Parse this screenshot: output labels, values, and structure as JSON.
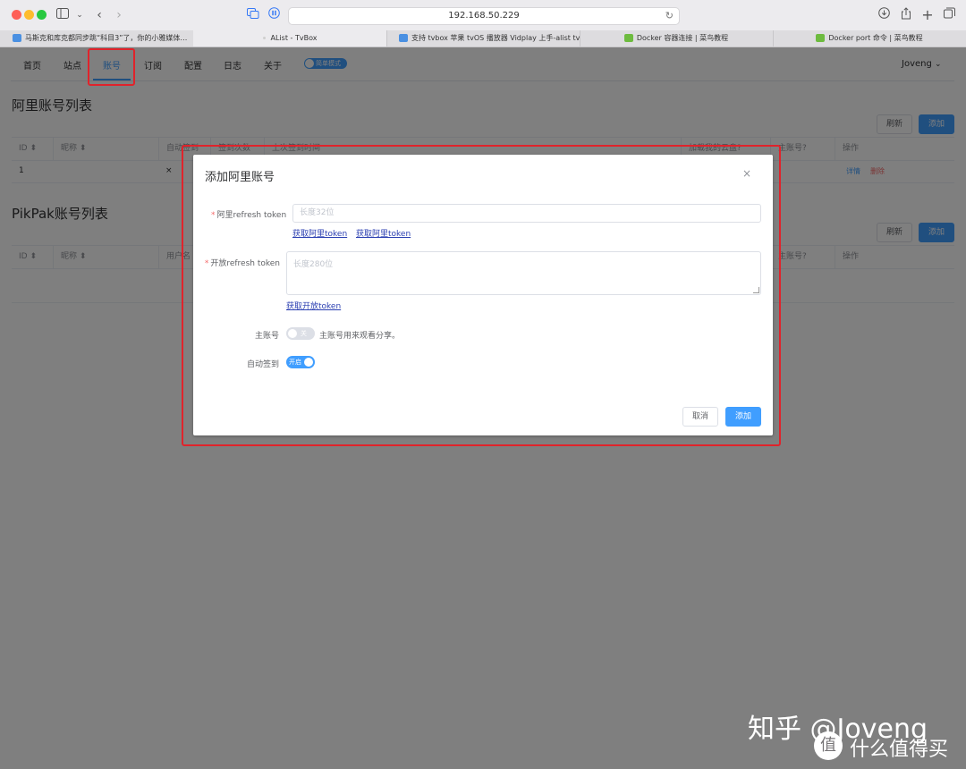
{
  "browser": {
    "url": "192.168.50.229",
    "tabs": [
      {
        "label": "马斯克和库克都同步跳“科目3”了，你的小雅媒体…",
        "favicon": "#4a90e2"
      },
      {
        "label": "AList - TvBox",
        "favicon": "#cfcfcf"
      },
      {
        "label": "支持 tvbox 苹果 tvOS 播放器 Vidplay 上手-alist tvb…",
        "favicon": "#4a90e2"
      },
      {
        "label": "Docker 容器连接 | 菜鸟教程",
        "favicon": "#6dbb3f"
      },
      {
        "label": "Docker port 命令 | 菜鸟教程",
        "favicon": "#6dbb3f"
      }
    ]
  },
  "nav": {
    "items": [
      "首页",
      "站点",
      "账号",
      "订阅",
      "配置",
      "日志",
      "关于"
    ],
    "active_index": 2,
    "simple_mode_label": "简单模式",
    "user": "Joveng"
  },
  "ali_section": {
    "title": "阿里账号列表",
    "refresh": "刷新",
    "add": "添加",
    "columns": [
      "ID",
      "昵称",
      "自动签到",
      "签到次数",
      "上次签到时间",
      "加载我的云盘?",
      "主账号?",
      "操作"
    ],
    "rows": [
      {
        "id": "1",
        "nickname": "",
        "auto_sign": "×",
        "detail": "详情",
        "delete": "删除"
      }
    ]
  },
  "pikpak_section": {
    "title": "PikPak账号列表",
    "refresh": "刷新",
    "add": "添加",
    "columns": [
      "ID",
      "昵称",
      "用户名",
      "主账号?",
      "操作"
    ]
  },
  "dialog": {
    "title": "添加阿里账号",
    "close": "×",
    "ali_token_label": "阿里refresh token",
    "ali_token_placeholder": "长度32位",
    "ali_links": [
      "获取阿里token",
      "获取阿里token"
    ],
    "open_token_label": "开放refresh token",
    "open_token_placeholder": "长度280位",
    "open_link": "获取开放token",
    "main_label": "主账号",
    "main_switch_text": "关",
    "main_helper": "主账号用来观看分享。",
    "auto_label": "自动签到",
    "auto_switch_text": "开启",
    "cancel": "取消",
    "add": "添加"
  },
  "watermark": {
    "text": "知乎 @Joveng",
    "logo_glyph": "值",
    "logo_text": "什么值得买"
  },
  "colors": {
    "primary": "#409eff",
    "danger": "#f56c6c",
    "highlight": "#e0232b"
  }
}
